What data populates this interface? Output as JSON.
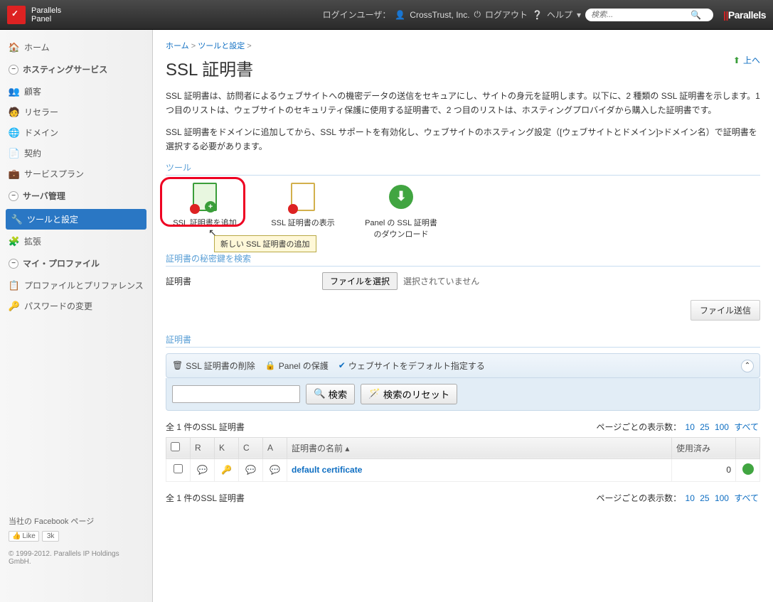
{
  "topbar": {
    "logo_top": "Parallels",
    "logo_bottom": "Panel",
    "login_label": "ログインユーザ：",
    "user": "CrossTrust, Inc.",
    "logout": "ログアウト",
    "help": "ヘルプ",
    "search_placeholder": "検索...",
    "right_logo": "Parallels"
  },
  "sidebar": {
    "home": "ホーム",
    "hosting_section": "ホスティングサービス",
    "customers": "顧客",
    "resellers": "リセラー",
    "domains": "ドメイン",
    "subscriptions": "契約",
    "service_plans": "サービスプラン",
    "server_section": "サーバ管理",
    "tools_settings": "ツールと設定",
    "extensions": "拡張",
    "profile_section": "マイ・プロファイル",
    "profile_prefs": "プロファイルとプリファレンス",
    "change_password": "パスワードの変更",
    "footer_fb": "当社の Facebook ページ",
    "like": "Like",
    "like_count": "3k",
    "copyright": "© 1999-2012. Parallels IP Holdings GmbH."
  },
  "breadcrumb": {
    "home": "ホーム",
    "tools": "ツールと設定"
  },
  "page": {
    "title": "SSL 証明書",
    "up": "上へ",
    "desc1": "SSL 証明書は、訪問者によるウェブサイトへの機密データの送信をセキュアにし、サイトの身元を証明します。以下に、2 種類の SSL 証明書を示します。1 つ目のリストは、ウェブサイトのセキュリティ保護に使用する証明書で、2 つ目のリストは、ホスティングプロバイダから購入した証明書です。",
    "desc2": "SSL 証明書をドメインに追加してから、SSL サポートを有効化し、ウェブサイトのホスティング設定（[ウェブサイトとドメイン]>ドメイン名）で証明書を選択する必要があります。",
    "tools_label": "ツール",
    "tool_add": "SSL 証明書を追加",
    "tool_view": "SSL 証明書の表示",
    "tool_download": "Panel の SSL 証明書のダウンロード",
    "tooltip": "新しい SSL 証明書の追加",
    "find_key_label": "証明書の秘密鍵を検索",
    "cert_label": "証明書",
    "file_select": "ファイルを選択",
    "file_hint": "選択されていません",
    "file_send": "ファイル送信",
    "certs_section": "証明書",
    "delete_cert": "SSL 証明書の削除",
    "panel_protect": "Panel の保護",
    "default_site": "ウェブサイトをデフォルト指定する",
    "search_btn": "検索",
    "reset_btn": "検索のリセット",
    "total_pre": "全 ",
    "total_count": "1",
    "total_post": " 件のSSL 証明書",
    "per_page": "ページごとの表示数：",
    "pp10": "10",
    "pp25": "25",
    "pp100": "100",
    "pp_all": "すべて"
  },
  "table": {
    "col_r": "R",
    "col_k": "K",
    "col_c": "C",
    "col_a": "A",
    "col_name": "証明書の名前",
    "col_used": "使用済み",
    "row_name": "default certificate",
    "row_used": "0"
  }
}
